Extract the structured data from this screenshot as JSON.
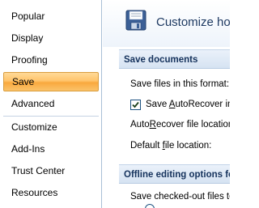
{
  "sidebar": {
    "items": [
      {
        "label": "Popular"
      },
      {
        "label": "Display"
      },
      {
        "label": "Proofing"
      },
      {
        "label": "Save",
        "selected": true
      },
      {
        "label": "Advanced"
      },
      {
        "label": "Customize"
      },
      {
        "label": "Add-Ins"
      },
      {
        "label": "Trust Center"
      },
      {
        "label": "Resources"
      }
    ]
  },
  "header": {
    "title": "Customize how",
    "icon": "floppy-disk-icon"
  },
  "sections": {
    "save_documents": {
      "title": "Save documents",
      "save_format_label": "Save files in this format:",
      "autorecover_checkbox": {
        "label_pre": "Save ",
        "label_ul": "A",
        "label_post": "utoRecover in",
        "checked": true
      },
      "autorecover_location": {
        "label_pre": "Auto",
        "label_ul": "R",
        "label_post": "ecover file location"
      },
      "default_location": {
        "label_pre": "Default ",
        "label_ul": "f",
        "label_post": "ile location:"
      }
    },
    "offline_editing": {
      "title": "Offline editing options fo",
      "checked_out_label": "Save checked-out files to"
    }
  },
  "colors": {
    "selected_gradient_top": "#ffd998",
    "selected_gradient_bottom": "#f9a93e",
    "section_header_text": "#15325c",
    "header_title_text": "#1e3a62"
  }
}
